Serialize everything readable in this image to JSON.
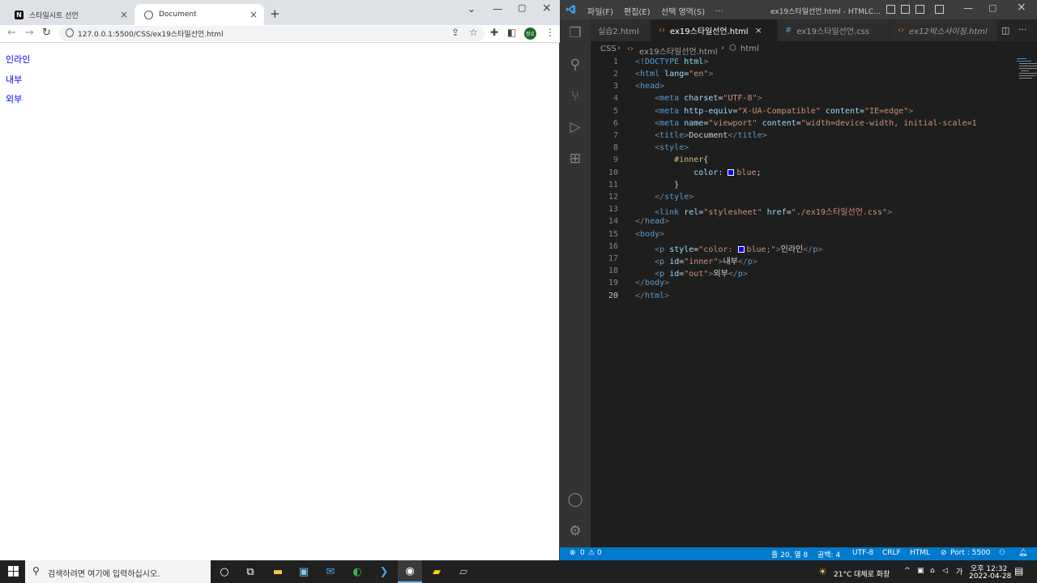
{
  "browser": {
    "tabs": [
      {
        "label": "스타일시트 선언",
        "favicon": "notion-icon"
      },
      {
        "label": "Document",
        "favicon": "globe-icon"
      }
    ],
    "url": "127.0.0.1:5500/CSS/ex19스타일선언.html",
    "profile_initials": "정호",
    "page_lines": [
      "인라인",
      "내부",
      "외부"
    ]
  },
  "vscode": {
    "menu": [
      "파일(F)",
      "편집(E)",
      "선택 영역(S)",
      "..."
    ],
    "window_title": "ex19스타일선언.html - HTMLC...",
    "tabs": [
      {
        "label": "실습2.html",
        "icon": "html-icon",
        "active": false
      },
      {
        "label": "ex19스타일선언.html",
        "icon": "html-icon",
        "active": true
      },
      {
        "label": "ex19스타일선언.css",
        "icon": "css-icon",
        "active": false
      },
      {
        "label": "ex12박스사이징.html",
        "icon": "html-icon",
        "active": false
      }
    ],
    "breadcrumb": [
      "CSS",
      "ex19스타일선언.html",
      "html"
    ],
    "line_numbers": [
      "1",
      "2",
      "3",
      "4",
      "5",
      "6",
      "7",
      "8",
      "9",
      "10",
      "11",
      "12",
      "13",
      "14",
      "15",
      "16",
      "17",
      "18",
      "19",
      "20"
    ],
    "status": {
      "errors": "0",
      "warnings": "0",
      "position": "줄 20, 열 8",
      "spaces": "공백: 4",
      "encoding": "UTF-8",
      "eol": "CRLF",
      "language": "HTML",
      "port": "Port : 5500"
    }
  },
  "taskbar": {
    "search_placeholder": "검색하려면 여기에 입력하십시오.",
    "weather": "21°C  대체로 화창",
    "time": "오후 12:32",
    "date": "2022-04-28"
  },
  "colors": {
    "accent": "#007acc",
    "link_blue": "#0000ff"
  }
}
